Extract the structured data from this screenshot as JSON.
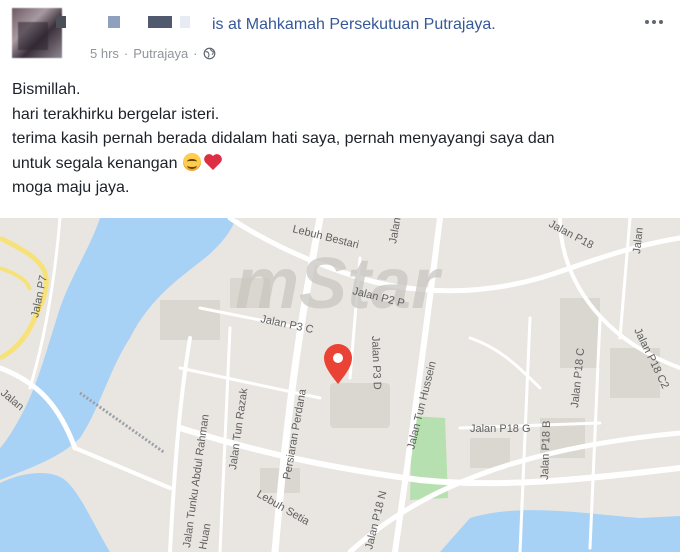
{
  "post": {
    "action": "is at Mahkamah Persekutuan Putrajaya.",
    "time": "5 hrs",
    "separator": "·",
    "location": "Putrajaya",
    "privacy_icon": "globe-icon",
    "more_icon": "more-options-icon",
    "lines": [
      "Bismillah.",
      "hari terakhirku bergelar isteri.",
      "terima kasih pernah berada didalam hati saya, pernah menyayangi saya dan",
      "untuk segala kenangan",
      "moga maju jaya."
    ],
    "emojis": [
      "smiling-face-emoji",
      "red-heart-emoji"
    ]
  },
  "map": {
    "watermark": "mStar",
    "marker_icon": "map-pin-icon",
    "streets": {
      "lebuh_bestari": "Lebuh Bestari",
      "jalan_p2p": "Jalan P2 P",
      "jalan_p3c": "Jalan P3 C",
      "jalan_p7": "Jalan P7",
      "jalan_p18": "Jalan P18",
      "jalan_p18c": "Jalan P18 C",
      "jalan_p18c2": "Jalan P18 C2",
      "jalan_p18g": "Jalan P18 G",
      "jalan_p18b": "Jalan P18 B",
      "jalan_p18n": "Jalan P18 N",
      "jalan_tun_hussein": "Jalan Tun Hussein",
      "persiaran_perdana": "Persiaran Perdana",
      "jalan_tun_razak": "Jalan Tun Razak",
      "jalan_tunku_abdul_rahman": "Jalan Tunku Abdul Rahman",
      "lebuh_setia": "Lebuh Setia",
      "jalan_p3d": "Jalan P3 D",
      "jalan_top": "Jalan",
      "jalan_right": "Jalan",
      "huan": "Huan",
      "jalan_left_bottom": "Jalan"
    },
    "colors": {
      "land": "#e9e6e1",
      "water": "#a8d2f5",
      "road": "#ffffff",
      "highway": "#f7e27a",
      "park": "#b7e0b0",
      "block": "#dad6d0",
      "marker": "#ea4335"
    }
  }
}
